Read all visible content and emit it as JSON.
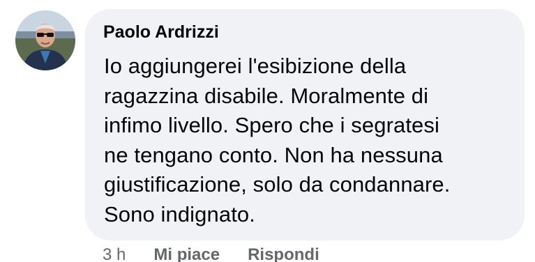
{
  "comment": {
    "author": "Paolo Ardrizzi",
    "avatar_icon": "user-avatar-photo",
    "text": "Io aggiungerei l'esibizione della\nragazzina disabile.  Moralmente di\ninfimo livello. Spero che i segratesi\nne tengano conto. Non ha nessuna\ngiustificazione, solo da condannare.\nSono indignato.",
    "bubble_color": "#f0f2f5"
  },
  "actions": {
    "time": "3 h",
    "like_label": "Mi piace",
    "reply_label": "Rispondi"
  }
}
